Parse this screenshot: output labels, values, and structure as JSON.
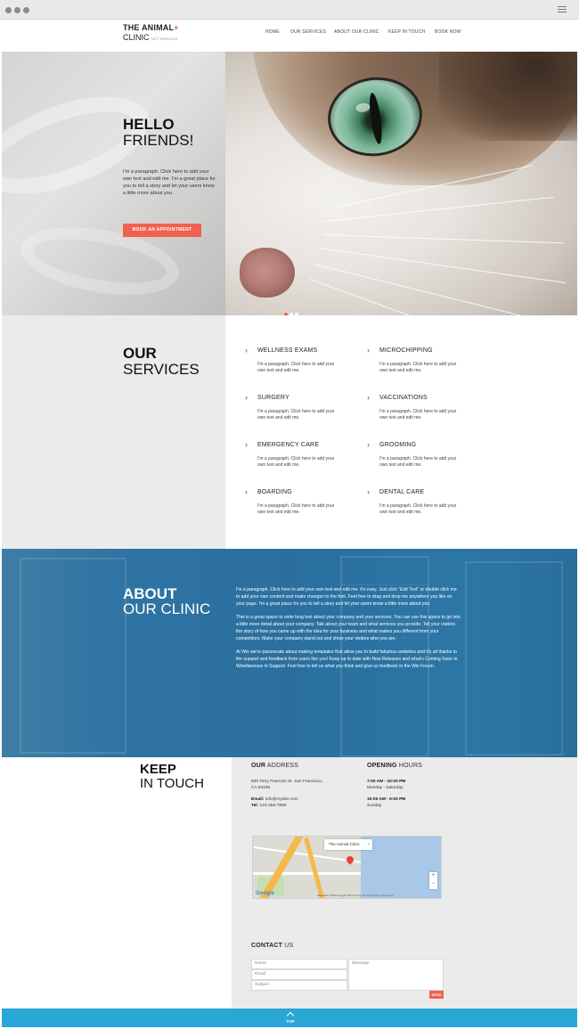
{
  "site": {
    "logo_line1": "THE ANIMAL",
    "logo_plus": "+",
    "logo_line2": "CLINIC",
    "logo_tag": "VET SERVICE"
  },
  "nav": {
    "items": [
      "HOME",
      "OUR SERVICES",
      "ABOUT OUR CLINIC",
      "KEEP IN TOUCH",
      "BOOK NOW"
    ]
  },
  "hero": {
    "title_bold": "HELLO",
    "title_normal": "FRIENDS!",
    "paragraph": "I'm a paragraph. Click here to add your own text and edit me. I'm a great place for you to tell a story and let your users know a little more about you.",
    "button_label": "BOOK AN APPOINTMENT",
    "slides_total": 3,
    "slide_active": 1
  },
  "services": {
    "title_bold": "OUR",
    "title_normal": "SERVICES",
    "chevron": "›",
    "items": [
      {
        "name": "WELLNESS EXAMS",
        "desc": "I'm a paragraph. Click here to add your own text and edit me."
      },
      {
        "name": "MICROCHIPPING",
        "desc": "I'm a paragraph. Click here to add your own text and edit me."
      },
      {
        "name": "SURGERY",
        "desc": "I'm a paragraph. Click here to add your own text and edit me."
      },
      {
        "name": "VACCINATIONS",
        "desc": "I'm a paragraph. Click here to add your own text and edit me."
      },
      {
        "name": "EMERGENCY CARE",
        "desc": "I'm a paragraph. Click here to add your own text and edit me."
      },
      {
        "name": "GROOMING",
        "desc": "I'm a paragraph. Click here to add your own text and edit me."
      },
      {
        "name": "BOARDING",
        "desc": "I'm a paragraph. Click here to add your own text and edit me."
      },
      {
        "name": "DENTAL CARE",
        "desc": "I'm a paragraph. Click here to add your own text and edit me."
      }
    ]
  },
  "about": {
    "title_bold": "ABOUT",
    "title_normal": "OUR CLINIC",
    "paragraphs": [
      "I'm a paragraph. Click here to add your own text and edit me. It's easy. Just click \"Edit Text\" or double click me to add your own content and make changes to the font. Feel free to drag and drop me anywhere you like on your page. I'm a great place for you to tell a story and let your users know a little more about you.",
      "This is a great space to write long text about your company and your services. You can use this space to go into a little more detail about your company. Talk about your team and what services you provide. Tell your visitors the story of how you came up with the idea for your business and what makes you different from your competitors. Make your company stand out and show your visitors who you are.",
      "At Wix we're passionate about making templates that allow you to build fabulous websites and it's all thanks to the support and feedback from users like you! Keep up to date with New Releases and what's Coming Soon in Wixellaneous in Support. Feel free to tell us what you think and give us feedback in the Wix Forum."
    ]
  },
  "touch": {
    "title_bold": "KEEP",
    "title_normal": "IN TOUCH",
    "address_head_bold": "OUR",
    "address_head_rest": " ADDRESS",
    "address_line1": "500 Terry Francois St. San Francisco,",
    "address_line2": "CA 94158",
    "email_label": "Email:",
    "email_value": " info@mysite.com",
    "tel_label": "Tel:",
    "tel_value": " 123-456-7890",
    "hours_head_bold": "OPENING",
    "hours_head_rest": " HOURS",
    "hours1_time": "7:00 AM - 10:00 PM",
    "hours1_days": "Monday - Saturday",
    "hours2_time": "10:00 AM - 6:00 PM",
    "hours2_days": "Sunday",
    "map_info": "The Animal Clinic",
    "map_close": "×",
    "map_zoom_in": "+",
    "map_zoom_out": "−",
    "map_google": "Google",
    "map_attr": "Map data ©2015 Google   500 ft   Terms of Use   Report a map error",
    "contact_head_bold": "CONTACT",
    "contact_head_rest": " US",
    "field_name": "Name",
    "field_email": "Email",
    "field_subject": "Subject",
    "field_message": "Message",
    "send_label": "SEND"
  },
  "footer": {
    "top_label": "TOP"
  },
  "colors": {
    "accent": "#f0614f",
    "blue": "#2aa7d6",
    "about_bg": "#2a6f9f"
  }
}
